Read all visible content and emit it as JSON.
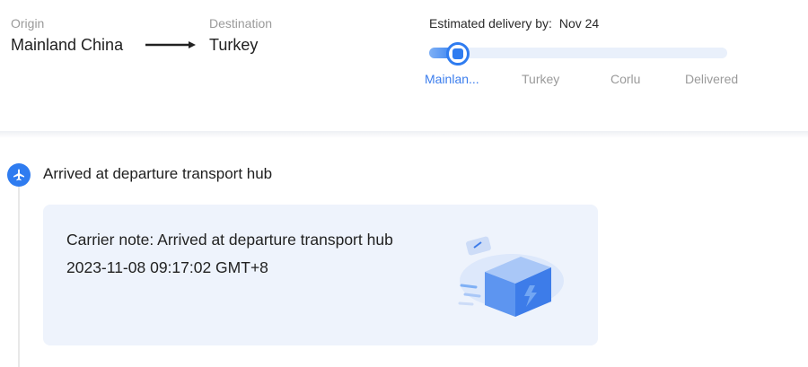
{
  "route": {
    "origin_label": "Origin",
    "origin_value": "Mainland China",
    "destination_label": "Destination",
    "destination_value": "Turkey"
  },
  "eta": {
    "label": "Estimated delivery by:",
    "date": "Nov 24"
  },
  "progress": {
    "fraction": 0.1,
    "stages": [
      "Mainlan...",
      "Turkey",
      "Corlu",
      "Delivered"
    ],
    "active_index": 0
  },
  "event": {
    "title": "Arrived at departure transport hub",
    "note": "Carrier note: Arrived at departure transport hub",
    "timestamp": "2023-11-08 09:17:02 GMT+8"
  },
  "colors": {
    "accent": "#2f7cf0",
    "card_bg": "#eef3fc",
    "muted": "#9a9a9a"
  },
  "icons": {
    "route_arrow": "arrow-right-icon",
    "event": "airplane-icon",
    "illustration": "package-box-icon"
  }
}
